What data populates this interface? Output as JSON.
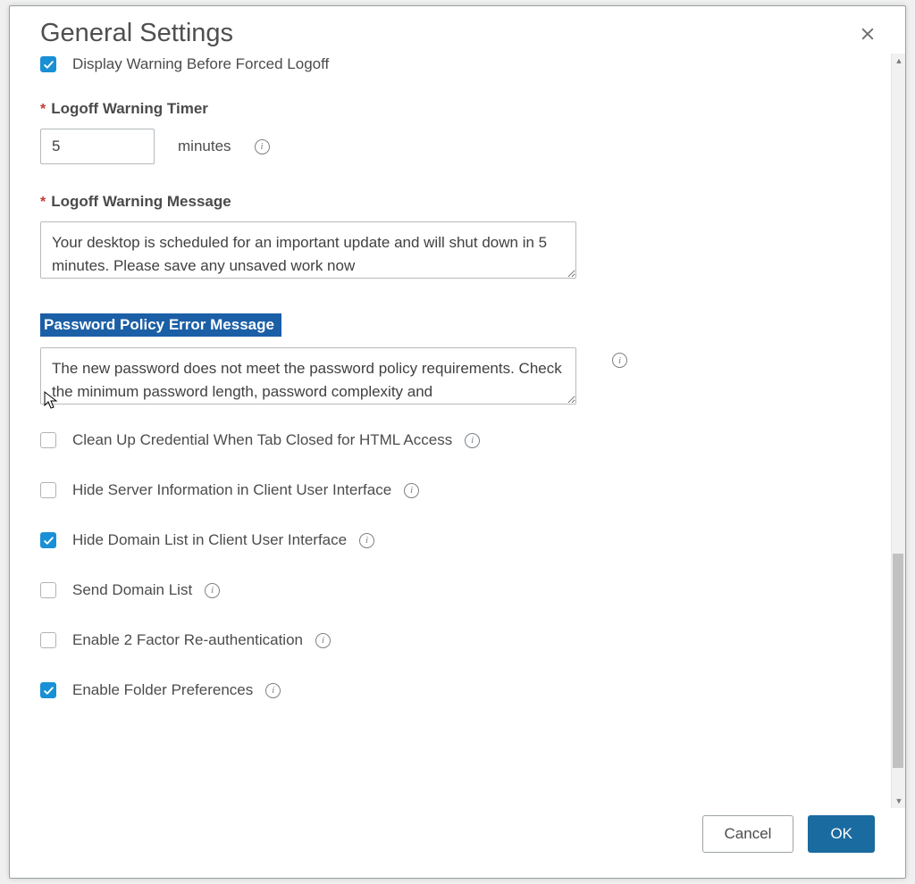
{
  "dialog": {
    "title": "General Settings",
    "display_warning_forced_logon": {
      "label": "Display Warning Before Forced Logoff",
      "checked": true
    },
    "logoff_timer": {
      "label": "Logoff Warning Timer",
      "value": "5",
      "unit": "minutes"
    },
    "logoff_message": {
      "label": "Logoff Warning Message",
      "value": "Your desktop is scheduled for an important update and will shut down in 5 minutes. Please save any unsaved work now"
    },
    "password_policy": {
      "label": "Password Policy Error Message",
      "value": "The new password does not meet the password policy requirements. Check the minimum password length, password complexity and"
    },
    "checkboxes": [
      {
        "key": "cleanup-cred",
        "label": "Clean Up Credential When Tab Closed for HTML Access",
        "checked": false,
        "info": true
      },
      {
        "key": "hide-server-info",
        "label": "Hide Server Information in Client User Interface",
        "checked": false,
        "info": true
      },
      {
        "key": "hide-domain-list",
        "label": "Hide Domain List in Client User Interface",
        "checked": true,
        "info": true
      },
      {
        "key": "send-domain-list",
        "label": "Send Domain List",
        "checked": false,
        "info": true
      },
      {
        "key": "enable-2fa-reauth",
        "label": "Enable 2 Factor Re-authentication",
        "checked": false,
        "info": true
      },
      {
        "key": "enable-folder-prefs",
        "label": "Enable Folder Preferences",
        "checked": true,
        "info": true
      }
    ],
    "buttons": {
      "cancel": "Cancel",
      "ok": "OK"
    }
  }
}
